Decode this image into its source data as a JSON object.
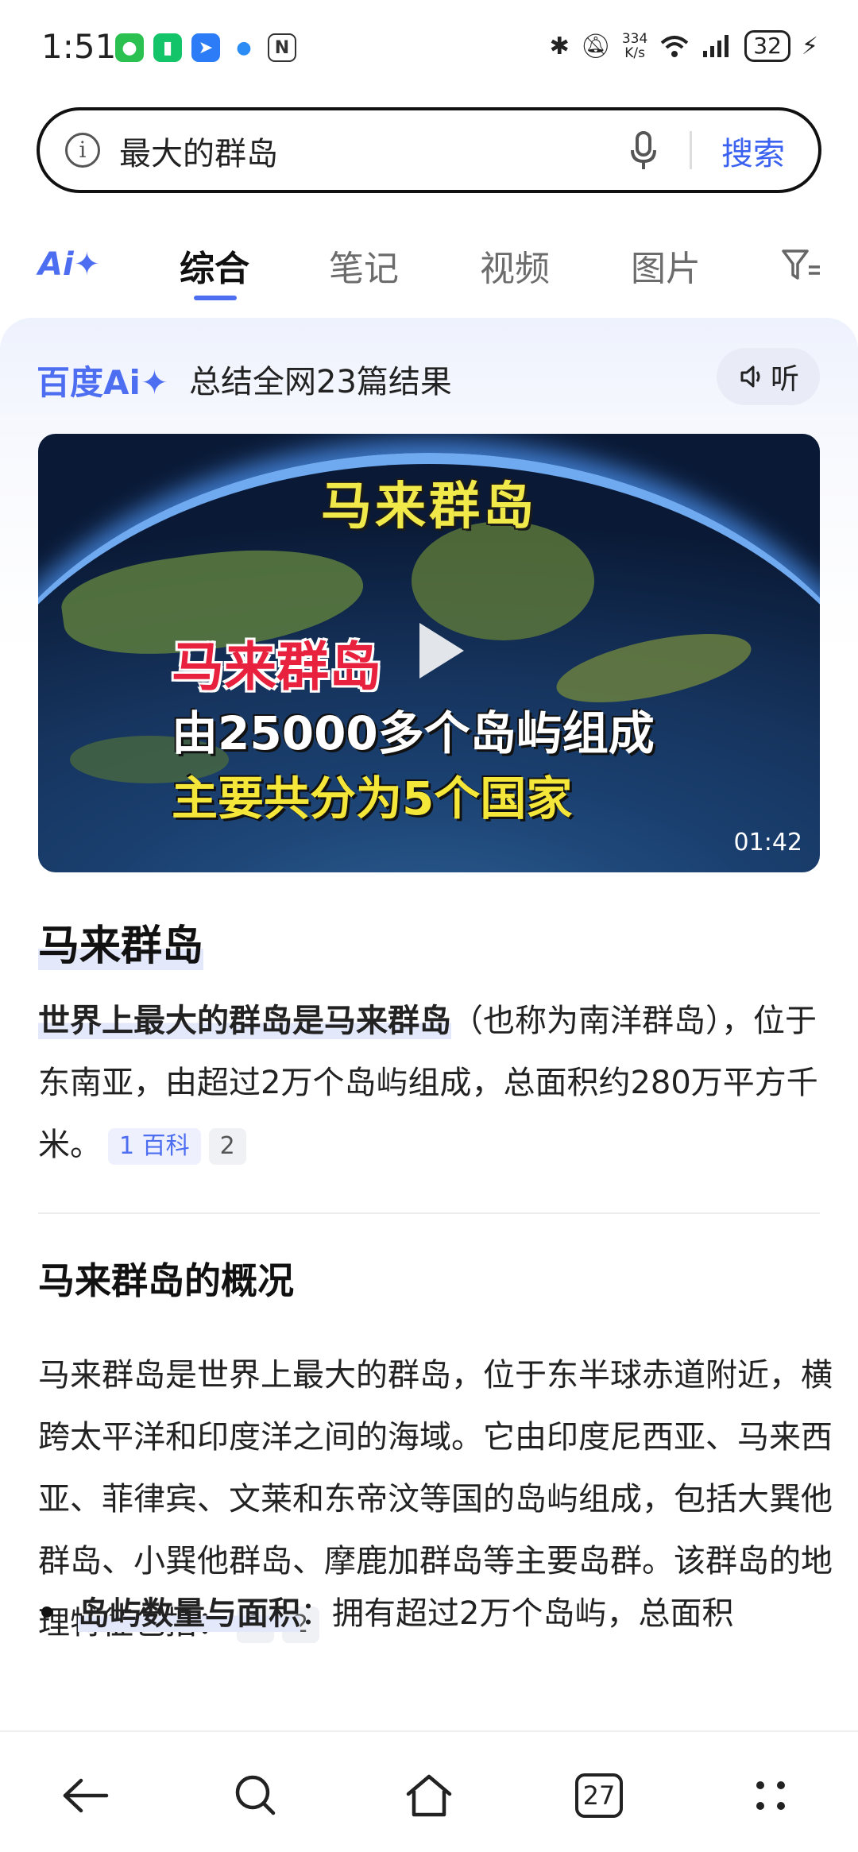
{
  "status_bar": {
    "time": "1:51",
    "net_speed_value": "334",
    "net_speed_unit": "K/s",
    "battery": "32"
  },
  "search": {
    "query": "最大的群岛",
    "button": "搜索"
  },
  "tabs": {
    "ai_logo": "Ai✦",
    "items": [
      "综合",
      "笔记",
      "视频",
      "图片"
    ]
  },
  "ai_summary": {
    "logo": "百度Ai✦",
    "summary_text": "总结全网23篇结果",
    "listen_label": "听",
    "video": {
      "title": "马来群岛",
      "line1": "马来群岛",
      "line2": "由25000多个岛屿组成",
      "line3": "主要共分为5个国家",
      "duration": "01:42"
    },
    "heading": "马来群岛",
    "para1_highlight": "世界上最大的群岛是马来群岛",
    "para1_rest": "（也称为南洋群岛），位于东南亚，由超过2万个岛屿组成，总面积约280万平方千米。",
    "para1_source_num": "1",
    "para1_source_name": "百科",
    "para1_ref2": "2",
    "section_heading": "马来群岛的概况",
    "para2": "马来群岛是世界上最大的群岛，位于东半球赤道附近，横跨太平洋和印度洋之间的海域。它由印度尼西亚、马来西亚、菲律宾、文莱和东帝汶等国的岛屿组成，包括大巽他群岛、小巽他群岛、摩鹿加群岛等主要岛群。该群岛的地理特征包括：",
    "para2_ref1": "1",
    "para2_ref2": "2",
    "bullet1_title": "岛屿数量与面积",
    "bullet1_text": "：拥有超过2万个岛屿，总面积"
  },
  "bottom_nav": {
    "tab_count": "27"
  },
  "colors": {
    "accent": "#4e6ef2",
    "search_button": "#3a61f0"
  }
}
